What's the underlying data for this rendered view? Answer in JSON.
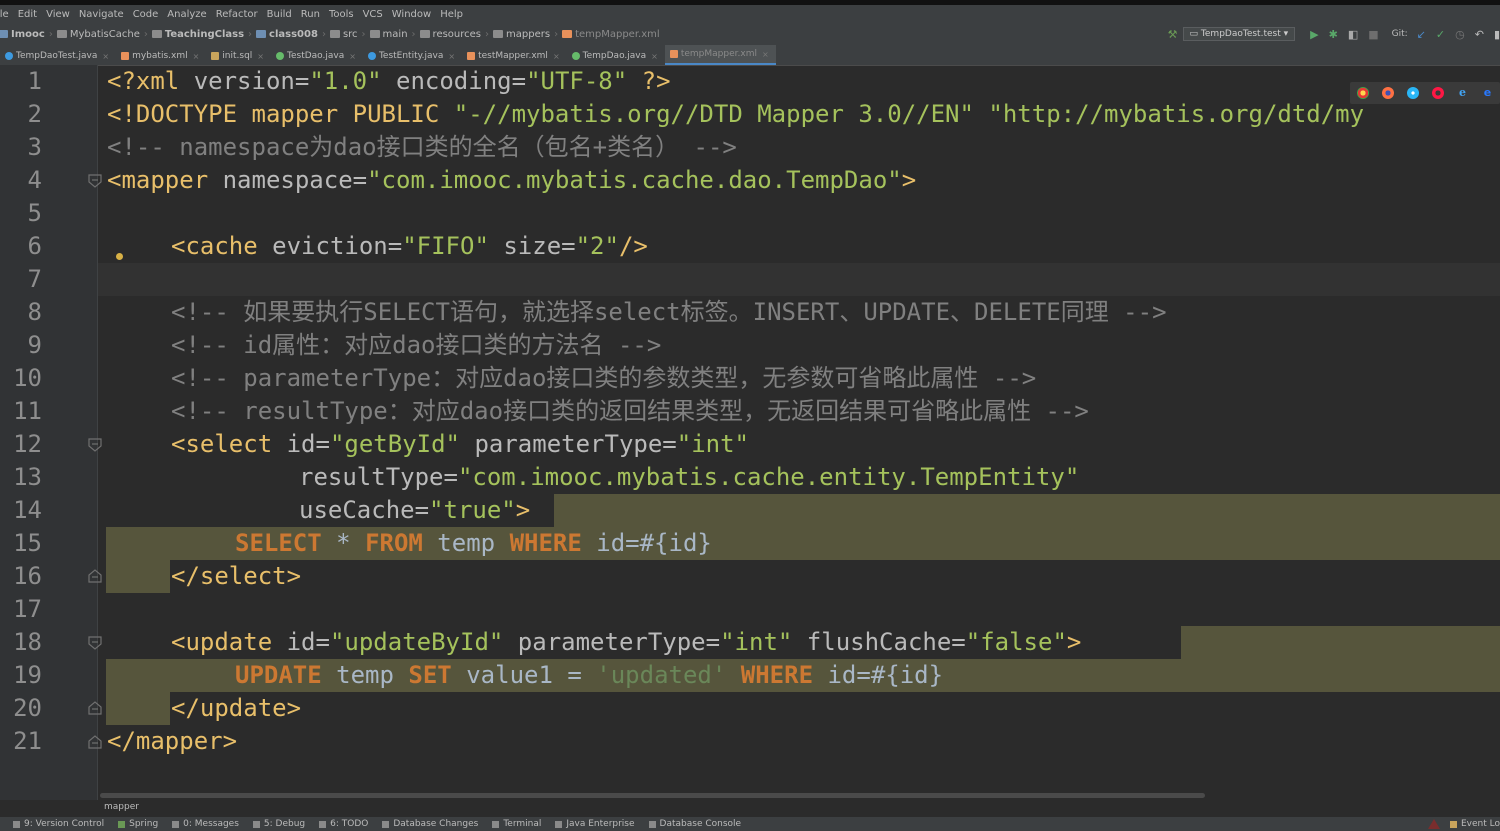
{
  "menu": [
    "ile",
    "Edit",
    "View",
    "Navigate",
    "Code",
    "Analyze",
    "Refactor",
    "Build",
    "Run",
    "Tools",
    "VCS",
    "Window",
    "Help"
  ],
  "breadcrumbs": [
    {
      "label": "Imooc",
      "icon": "module-icon"
    },
    {
      "label": "MybatisCache",
      "icon": "folder-icon"
    },
    {
      "label": "TeachingClass",
      "icon": "folder-icon"
    },
    {
      "label": "class008",
      "icon": "module-icon"
    },
    {
      "label": "src",
      "icon": "folder-icon"
    },
    {
      "label": "main",
      "icon": "folder-icon"
    },
    {
      "label": "resources",
      "icon": "folder-icon"
    },
    {
      "label": "mappers",
      "icon": "folder-icon"
    },
    {
      "label": "tempMapper.xml",
      "icon": "xml-file-icon"
    }
  ],
  "run_config": "TempDaoTest.test",
  "git_label": "Git:",
  "tabs": [
    {
      "label": "TempDaoTest.java",
      "color": "#3d9ae0",
      "active": false
    },
    {
      "label": "mybatis.xml",
      "color": "#e8915b",
      "active": false
    },
    {
      "label": "init.sql",
      "color": "#c8a45c",
      "active": false
    },
    {
      "label": "TestDao.java",
      "color": "#66bb6a",
      "active": false
    },
    {
      "label": "TestEntity.java",
      "color": "#3d9ae0",
      "active": false
    },
    {
      "label": "testMapper.xml",
      "color": "#e8915b",
      "active": false
    },
    {
      "label": "TempDao.java",
      "color": "#66bb6a",
      "active": false
    },
    {
      "label": "tempMapper.xml",
      "color": "#e8915b",
      "active": true
    }
  ],
  "line_numbers": [
    "1",
    "2",
    "3",
    "4",
    "5",
    "6",
    "7",
    "8",
    "9",
    "10",
    "11",
    "12",
    "13",
    "14",
    "15",
    "16",
    "17",
    "18",
    "19",
    "20",
    "21"
  ],
  "code": {
    "l1_a": "<?xml ",
    "l1_b": "version",
    "l1_c": "=",
    "l1_d": "\"1.0\"",
    "l1_e": " encoding",
    "l1_f": "=",
    "l1_g": "\"UTF-8\"",
    "l1_h": " ?>",
    "l2_a": "<!DOCTYPE mapper PUBLIC ",
    "l2_b": "\"-//mybatis.org//DTD Mapper 3.0//EN\"",
    "l2_c": " \"http://mybatis.org/dtd/my",
    "l3": "<!-- namespace为dao接口类的全名（包名+类名） -->",
    "l4_a": "<mapper ",
    "l4_b": "namespace",
    "l4_c": "=",
    "l4_d": "\"com.imooc.mybatis.cache.dao.TempDao\"",
    "l4_e": ">",
    "l6_a": "<cache ",
    "l6_b": "eviction",
    "l6_c": "=",
    "l6_d": "\"FIFO\"",
    "l6_e": " size",
    "l6_f": "=",
    "l6_g": "\"2\"",
    "l6_h": "/>",
    "l8": "<!-- 如果要执行SELECT语句，就选择select标签。INSERT、UPDATE、DELETE同理 -->",
    "l9": "<!-- id属性：对应dao接口类的方法名 -->",
    "l10": "<!-- parameterType：对应dao接口类的参数类型，无参数可省略此属性 -->",
    "l11": "<!-- resultType：对应dao接口类的返回结果类型，无返回结果可省略此属性 -->",
    "l12_a": "<select ",
    "l12_b": "id",
    "l12_c": "=",
    "l12_d": "\"getById\"",
    "l12_e": " parameterType",
    "l12_f": "=",
    "l12_g": "\"int\"",
    "l13_a": "resultType",
    "l13_b": "=",
    "l13_c": "\"com.imooc.mybatis.cache.entity.TempEntity\"",
    "l14_a": "useCache",
    "l14_b": "=",
    "l14_c": "\"true\"",
    "l14_d": ">",
    "l15_a": "SELECT",
    "l15_b": " * ",
    "l15_c": "FROM",
    "l15_d": " temp ",
    "l15_e": "WHERE",
    "l15_f": " id=#{id}",
    "l16": "</select>",
    "l18_a": "<update ",
    "l18_b": "id",
    "l18_c": "=",
    "l18_d": "\"updateById\"",
    "l18_e": " parameterType",
    "l18_f": "=",
    "l18_g": "\"int\"",
    "l18_h": " flushCache",
    "l18_i": "=",
    "l18_j": "\"false\"",
    "l18_k": ">",
    "l19_a": "UPDATE",
    "l19_b": " temp ",
    "l19_c": "SET",
    "l19_d": " value1 = ",
    "l19_e": "'updated'",
    "l19_f": " ",
    "l19_g": "WHERE",
    "l19_h": " id=#{id}",
    "l20": "</update>",
    "l21": "</mapper>"
  },
  "footer_breadcrumb": "mapper",
  "status": [
    {
      "label": "9: Version Control"
    },
    {
      "label": "Spring"
    },
    {
      "label": "0: Messages"
    },
    {
      "label": "5: Debug"
    },
    {
      "label": "6: TODO"
    },
    {
      "label": "Database Changes"
    },
    {
      "label": "Terminal"
    },
    {
      "label": "Java Enterprise"
    },
    {
      "label": "Database Console"
    }
  ],
  "event_log": "Event Lo"
}
